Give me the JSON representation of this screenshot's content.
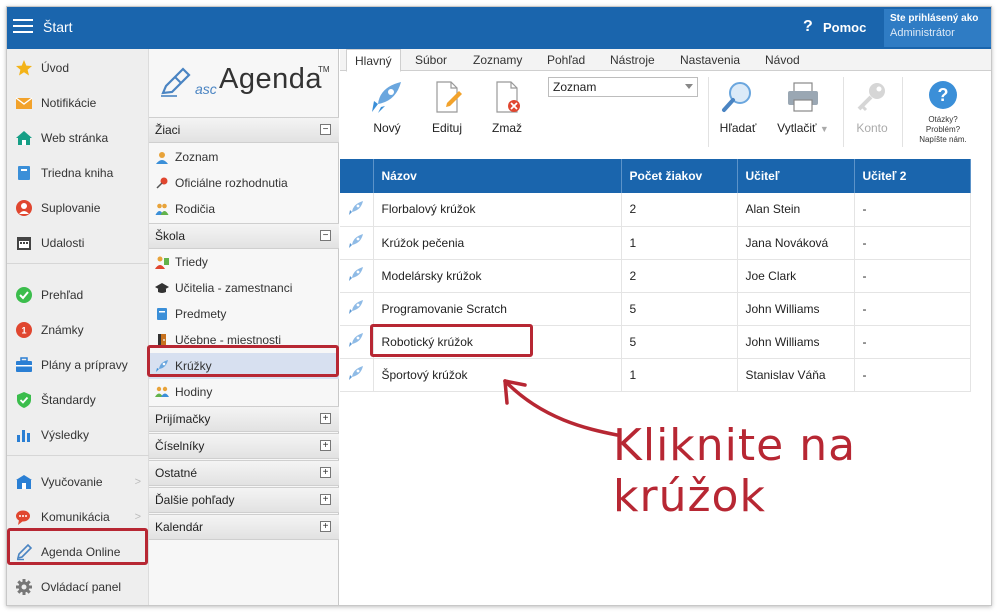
{
  "topbar": {
    "start_label": "Štart",
    "help_label": "Pomoc",
    "help_icon": "?",
    "login_line1": "Ste prihlásený ako",
    "login_line2": "Administrátor"
  },
  "sidebar": {
    "items": [
      {
        "label": "Úvod",
        "icon": "star-icon"
      },
      {
        "label": "Notifikácie",
        "icon": "envelope-icon"
      },
      {
        "label": "Web stránka",
        "icon": "house-icon"
      },
      {
        "label": "Triedna kniha",
        "icon": "book-icon"
      },
      {
        "label": "Suplovanie",
        "icon": "person-icon"
      },
      {
        "label": "Udalosti",
        "icon": "calendar-icon"
      },
      {
        "label": "Prehľad",
        "icon": "check-circle-icon"
      },
      {
        "label": "Známky",
        "icon": "grades-icon"
      },
      {
        "label": "Plány a prípravy",
        "icon": "briefcase-icon"
      },
      {
        "label": "Štandardy",
        "icon": "shield-check-icon"
      },
      {
        "label": "Výsledky",
        "icon": "bar-chart-icon"
      },
      {
        "label": "Vyučovanie",
        "icon": "school-icon"
      },
      {
        "label": "Komunikácia",
        "icon": "chat-icon"
      },
      {
        "label": "Agenda Online",
        "icon": "pen-icon"
      },
      {
        "label": "Ovládací panel",
        "icon": "cog-icon"
      }
    ]
  },
  "logo": {
    "asc": "asc",
    "agenda": "Agenda",
    "tm": "TM"
  },
  "midpanel": {
    "sections": [
      {
        "title": "Žiaci",
        "toggle": "−",
        "items": [
          "Zoznam",
          "Oficiálne rozhodnutia",
          "Rodičia"
        ]
      },
      {
        "title": "Škola",
        "toggle": "−",
        "items": [
          "Triedy",
          "Učitelia - zamestnanci",
          "Predmety",
          "Učebne - miestnosti",
          "Krúžky",
          "Hodiny"
        ]
      },
      {
        "title": "Prijímačky",
        "toggle": "+"
      },
      {
        "title": "Číselníky",
        "toggle": "+"
      },
      {
        "title": "Ostatné",
        "toggle": "+"
      },
      {
        "title": "Ďalšie pohľady",
        "toggle": "+"
      },
      {
        "title": "Kalendár",
        "toggle": "+"
      }
    ]
  },
  "ribbon": {
    "tabs": [
      "Hlavný",
      "Súbor",
      "Zoznamy",
      "Pohľad",
      "Nástroje",
      "Nastavenia",
      "Návod"
    ],
    "buttons": {
      "new": "Nový",
      "edit": "Edituj",
      "delete": "Zmaž",
      "search": "Hľadať",
      "print": "Vytlačiť",
      "account": "Konto"
    },
    "combo_value": "Zoznam",
    "help_q": [
      "Otázky?",
      "Problém?",
      "Napíšte nám."
    ]
  },
  "table": {
    "columns": [
      "Názov",
      "Počet žiakov",
      "Učiteľ",
      "Učiteľ 2"
    ],
    "rows": [
      [
        "Florbalový krúžok",
        "2",
        "Alan Stein",
        "-"
      ],
      [
        "Krúžok pečenia",
        "1",
        "Jana Nováková",
        "-"
      ],
      [
        "Modelársky krúžok",
        "2",
        "Joe Clark",
        "-"
      ],
      [
        "Programovanie Scratch",
        "5",
        "John Williams",
        "-"
      ],
      [
        "Robotický krúžok",
        "5",
        "John Williams",
        "-"
      ],
      [
        "Športový krúžok",
        "1",
        "Stanislav Váňa",
        "-"
      ]
    ]
  },
  "annotation": {
    "callout": "Kliknite na krúžok"
  },
  "colors": {
    "brand": "#1a65ad",
    "highlight": "#b72733",
    "active_bg": "#d7e0f0"
  }
}
